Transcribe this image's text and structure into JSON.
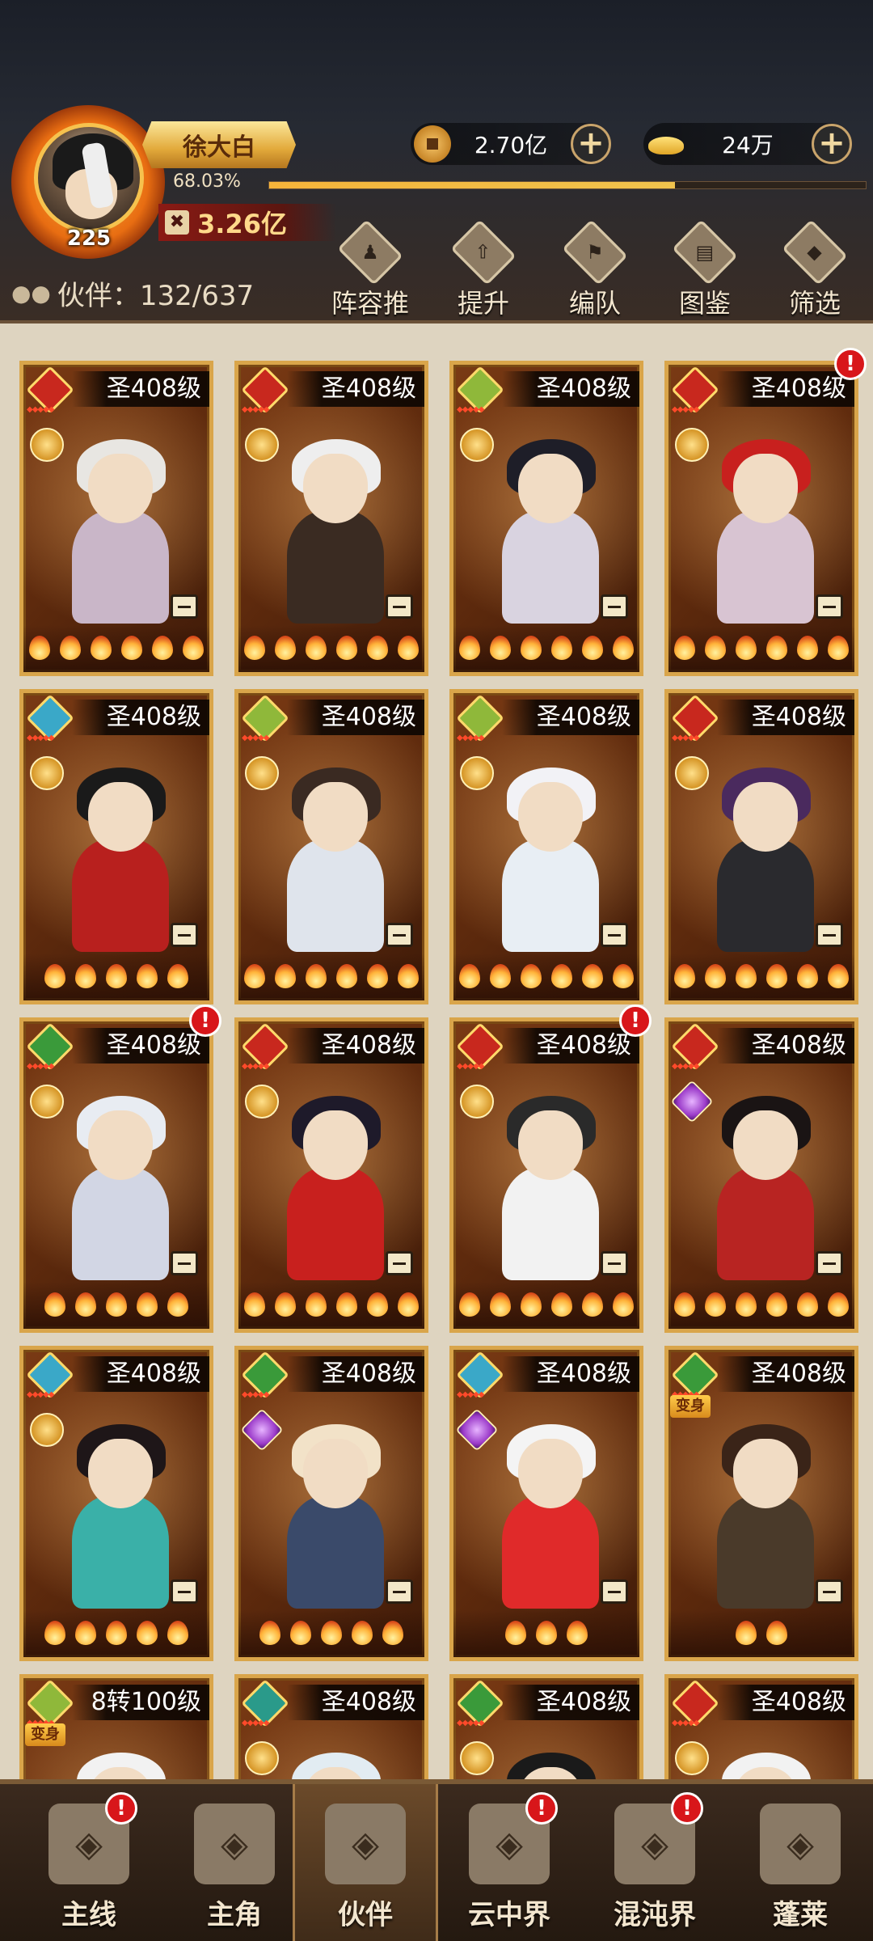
{
  "player": {
    "name": "徐大白",
    "level": "225",
    "exp_percent": "68.03%",
    "exp_fraction": 0.6803,
    "power": "3.26亿"
  },
  "currency": {
    "copper": "2.70亿",
    "gold": "24万"
  },
  "partners": {
    "count_label": "伙伴：132/637"
  },
  "toolbar": [
    {
      "label": "阵容推荐",
      "icon": "formation-recommend-icon"
    },
    {
      "label": "提升",
      "icon": "upgrade-icon"
    },
    {
      "label": "编队",
      "icon": "team-flag-icon"
    },
    {
      "label": "图鉴",
      "icon": "codex-scroll-icon"
    },
    {
      "label": "筛选",
      "icon": "filter-icon"
    }
  ],
  "cards": [
    {
      "level": "圣408级",
      "element": "fire",
      "elem_color": "#c8281e",
      "class": "gold",
      "flames": 6,
      "alert": false,
      "hair": "#e8e6e2",
      "outfit": "#c9b6c8"
    },
    {
      "level": "圣408级",
      "element": "fire",
      "elem_color": "#c8281e",
      "class": "gold",
      "flames": 6,
      "alert": false,
      "hair": "#eeeeee",
      "outfit": "#3a2b22"
    },
    {
      "level": "圣408级",
      "element": "wind",
      "elem_color": "#8fb83a",
      "class": "gold",
      "flames": 6,
      "alert": false,
      "hair": "#1e1e28",
      "outfit": "#d9d3e0"
    },
    {
      "level": "圣408级",
      "element": "fire",
      "elem_color": "#c8281e",
      "class": "gold",
      "flames": 6,
      "alert": true,
      "hair": "#c8201e",
      "outfit": "#d8c4d2"
    },
    {
      "level": "圣408级",
      "element": "water",
      "elem_color": "#3aa8c8",
      "class": "gold",
      "flames": 5,
      "alert": false,
      "hair": "#1a1a1a",
      "outfit": "#b8201e"
    },
    {
      "level": "圣408级",
      "element": "wind",
      "elem_color": "#8fb83a",
      "class": "gold",
      "flames": 6,
      "alert": false,
      "hair": "#3a2a22",
      "outfit": "#dfe4ec"
    },
    {
      "level": "圣408级",
      "element": "wind",
      "elem_color": "#8fb83a",
      "class": "gold",
      "flames": 6,
      "alert": false,
      "hair": "#f2f2f6",
      "outfit": "#e8eef4"
    },
    {
      "level": "圣408级",
      "element": "fire",
      "elem_color": "#c8281e",
      "class": "gold",
      "flames": 6,
      "alert": false,
      "hair": "#4a2a5e",
      "outfit": "#2a2a2e"
    },
    {
      "level": "圣408级",
      "element": "grass",
      "elem_color": "#3a9a3a",
      "class": "gold",
      "flames": 5,
      "alert": true,
      "hair": "#e8ecf2",
      "outfit": "#d2d6e4"
    },
    {
      "level": "圣408级",
      "element": "fire",
      "elem_color": "#c8281e",
      "class": "gold",
      "flames": 6,
      "alert": false,
      "hair": "#1e1a2a",
      "outfit": "#c8201e"
    },
    {
      "level": "圣408级",
      "element": "fire",
      "elem_color": "#c8281e",
      "class": "gold",
      "flames": 6,
      "alert": true,
      "hair": "#2a2a2a",
      "outfit": "#f2f2f2"
    },
    {
      "level": "圣408级",
      "element": "fire",
      "elem_color": "#c8281e",
      "class": "purple",
      "flames": 6,
      "alert": false,
      "hair": "#1a1414",
      "outfit": "#b82422"
    },
    {
      "level": "圣408级",
      "element": "water",
      "elem_color": "#3aa8c8",
      "class": "gold",
      "flames": 5,
      "alert": false,
      "hair": "#1e1618",
      "outfit": "#3ab0a8"
    },
    {
      "level": "圣408级",
      "element": "grass",
      "elem_color": "#3a9a3a",
      "class": "purple",
      "flames": 5,
      "alert": false,
      "hair": "#f2e2c8",
      "outfit": "#3a4a6a"
    },
    {
      "level": "圣408级",
      "element": "water",
      "elem_color": "#3aa8c8",
      "class": "purple",
      "flames": 3,
      "alert": false,
      "hair": "#f4f4f4",
      "outfit": "#e02a2a"
    },
    {
      "level": "圣408级",
      "element": "grass",
      "elem_color": "#3a9a3a",
      "class": "transform",
      "class_label": "变身",
      "flames": 2,
      "alert": false,
      "hair": "#3a2418",
      "outfit": "#4a3a2a"
    },
    {
      "level": "8转100级",
      "element": "wind",
      "elem_color": "#8fb83a",
      "class": "transform",
      "class_label": "变身",
      "flames": 0,
      "alert": false,
      "hair": "#f2f2f2",
      "outfit": "#c8a070"
    },
    {
      "level": "圣408级",
      "element": "water",
      "elem_color": "#2a9a8a",
      "class": "gold",
      "flames": 0,
      "alert": false,
      "hair": "#e2ecf2",
      "outfit": "#c8d6e0"
    },
    {
      "level": "圣408级",
      "element": "grass",
      "elem_color": "#3a9a3a",
      "class": "gold",
      "flames": 0,
      "alert": false,
      "hair": "#1a1a1a",
      "outfit": "#8a7a6a"
    },
    {
      "level": "圣408级",
      "element": "fire",
      "elem_color": "#c8281e",
      "class": "gold",
      "flames": 0,
      "alert": false,
      "hair": "#f2f2f2",
      "outfit": "#dfe8f0"
    }
  ],
  "alert_mark": "!",
  "nav": [
    {
      "label": "主线",
      "icon": "main-quest-icon",
      "badge": true,
      "active": false
    },
    {
      "label": "主角",
      "icon": "hero-icon",
      "badge": false,
      "active": false
    },
    {
      "label": "伙伴",
      "icon": "partner-icon",
      "badge": false,
      "active": true
    },
    {
      "label": "云中界",
      "icon": "cloud-realm-icon",
      "badge": true,
      "active": false
    },
    {
      "label": "混沌界",
      "icon": "chaos-realm-icon",
      "badge": true,
      "active": false
    },
    {
      "label": "蓬莱",
      "icon": "penglai-icon",
      "badge": false,
      "active": false
    }
  ]
}
